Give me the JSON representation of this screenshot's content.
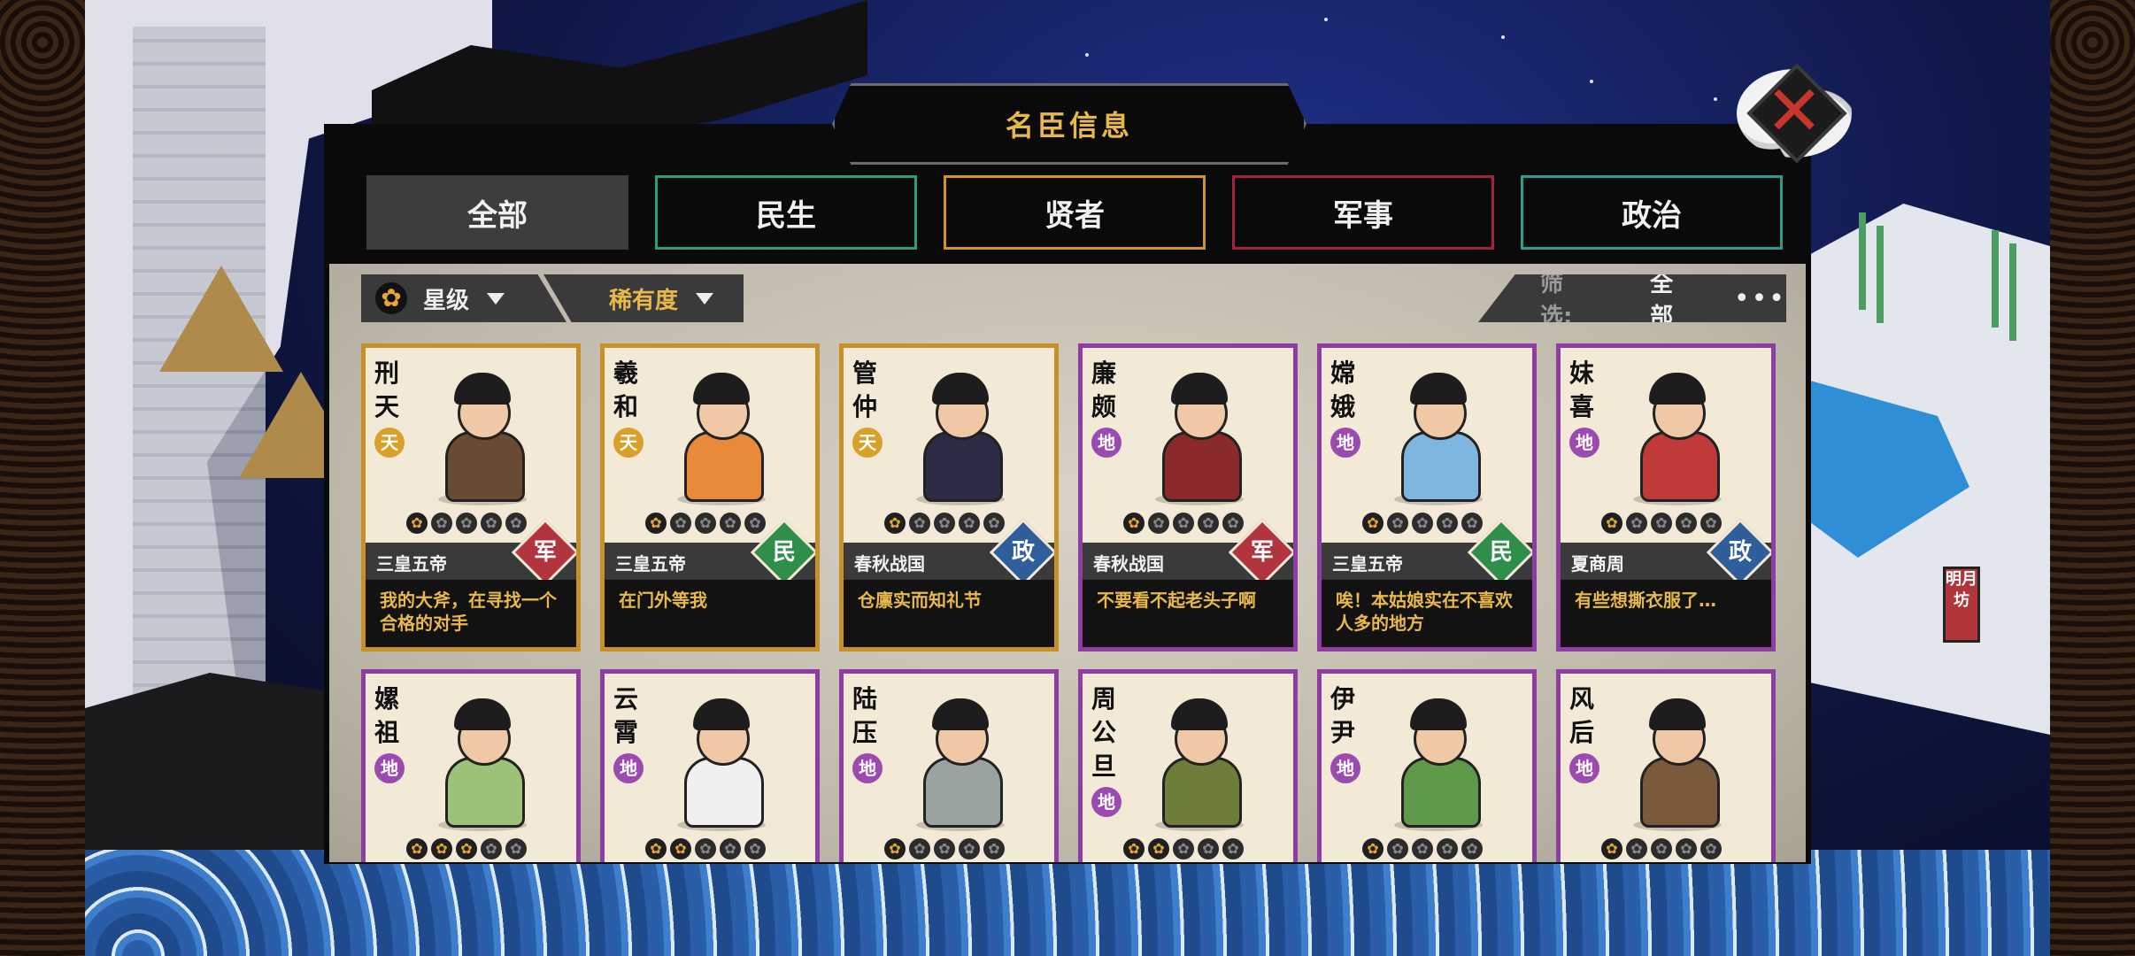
{
  "panel_title": "名臣信息",
  "tabs": [
    {
      "label": "全部",
      "active": true
    },
    {
      "label": "民生"
    },
    {
      "label": "贤者"
    },
    {
      "label": "军事"
    },
    {
      "label": "政治"
    }
  ],
  "filters": {
    "star_label": "星级",
    "rarity_label": "稀有度",
    "screen_label": "筛选:",
    "screen_value": "全部",
    "more": "•••"
  },
  "sign_text": "明月坊",
  "star_glyph": "✿",
  "colors": {
    "gold_border": "#c8902a",
    "purple_border": "#8e3ea2",
    "quote_text": "#e8b84b",
    "military": "#b2343f",
    "livelihood": "#2f8f4a",
    "politics": "#2f5f9a"
  },
  "cards": [
    {
      "name": "刑天",
      "rank": "天",
      "stars": 1,
      "era": "三皇五帝",
      "category": "军",
      "quote": "我的大斧，在寻找一个合格的对手",
      "frame": "gold"
    },
    {
      "name": "羲和",
      "rank": "天",
      "stars": 1,
      "era": "三皇五帝",
      "category": "民",
      "quote": "在门外等我",
      "frame": "gold"
    },
    {
      "name": "管仲",
      "rank": "天",
      "stars": 1,
      "era": "春秋战国",
      "category": "政",
      "quote": "仓廪实而知礼节",
      "frame": "gold"
    },
    {
      "name": "廉颇",
      "rank": "地",
      "stars": 1,
      "era": "春秋战国",
      "category": "军",
      "quote": "不要看不起老头子啊",
      "frame": "purple"
    },
    {
      "name": "嫦娥",
      "rank": "地",
      "stars": 1,
      "era": "三皇五帝",
      "category": "民",
      "quote": "唉！本姑娘实在不喜欢人多的地方",
      "frame": "purple"
    },
    {
      "name": "妺喜",
      "rank": "地",
      "stars": 1,
      "era": "夏商周",
      "category": "政",
      "quote": "有些想撕衣服了…",
      "frame": "purple"
    },
    {
      "name": "嫘祖",
      "rank": "地",
      "stars": 3,
      "era": "",
      "category": "",
      "quote": "",
      "frame": "purple"
    },
    {
      "name": "云霄",
      "rank": "地",
      "stars": 2,
      "era": "",
      "category": "",
      "quote": "",
      "frame": "purple"
    },
    {
      "name": "陆压",
      "rank": "地",
      "stars": 1,
      "era": "",
      "category": "",
      "quote": "",
      "frame": "purple"
    },
    {
      "name": "周公旦",
      "rank": "地",
      "stars": 2,
      "era": "",
      "category": "",
      "quote": "",
      "frame": "purple"
    },
    {
      "name": "伊尹",
      "rank": "地",
      "stars": 1,
      "era": "",
      "category": "",
      "quote": "",
      "frame": "purple"
    },
    {
      "name": "风后",
      "rank": "地",
      "stars": 1,
      "era": "",
      "category": "",
      "quote": "",
      "frame": "purple"
    }
  ]
}
